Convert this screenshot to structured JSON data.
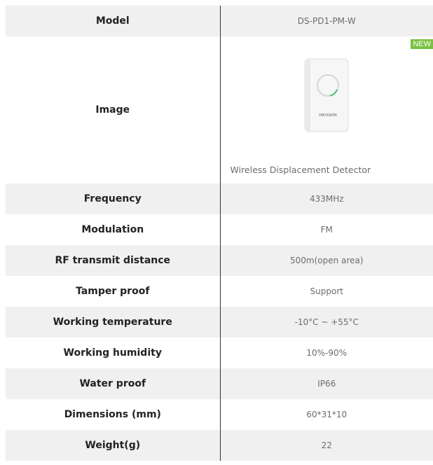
{
  "badge_new": "NEW",
  "image_row": {
    "label": "Image",
    "caption": "Wireless Displacement Detector"
  },
  "product_brand": "HIKVISION",
  "rows": [
    {
      "label": "Model",
      "value": "DS-PD1-PM-W"
    },
    {
      "label": "Frequency",
      "value": "433MHz"
    },
    {
      "label": "Modulation",
      "value": "FM"
    },
    {
      "label": "RF transmit distance",
      "value": "500m(open area)"
    },
    {
      "label": "Tamper proof",
      "value": "Support"
    },
    {
      "label": "Working temperature",
      "value": "-10°C ~ +55°C"
    },
    {
      "label": "Working humidity",
      "value": "10%-90%"
    },
    {
      "label": "Water proof",
      "value": "IP66"
    },
    {
      "label": "Dimensions (mm)",
      "value": "60*31*10"
    },
    {
      "label": "Weight(g)",
      "value": "22"
    }
  ],
  "colors": {
    "shade": "#f0f0f0",
    "badge": "#7ac143",
    "ring_accent": "#4cc76a"
  }
}
